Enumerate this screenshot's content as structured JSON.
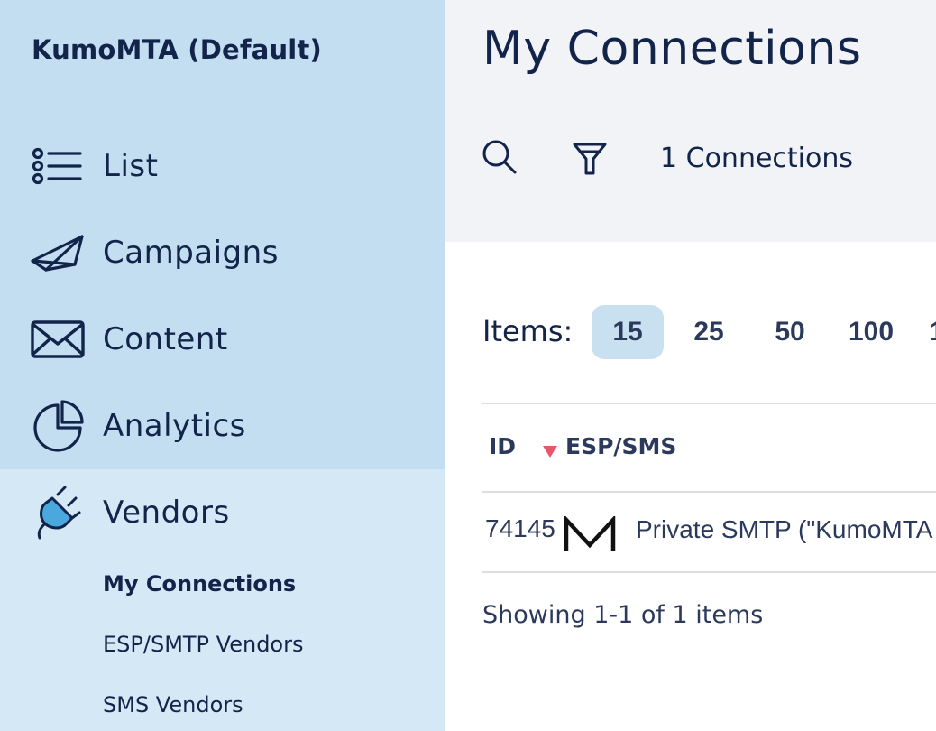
{
  "sidebar": {
    "org_name": "KumoMTA (Default)",
    "items": [
      {
        "label": "List",
        "icon": "list-icon"
      },
      {
        "label": "Campaigns",
        "icon": "paper-plane-icon"
      },
      {
        "label": "Content",
        "icon": "envelope-icon"
      },
      {
        "label": "Analytics",
        "icon": "pie-chart-icon"
      },
      {
        "label": "Vendors",
        "icon": "plug-icon"
      }
    ],
    "sub_items": [
      {
        "label": "My Connections",
        "active": true
      },
      {
        "label": "ESP/SMTP Vendors",
        "active": false
      },
      {
        "label": "SMS Vendors",
        "active": false
      }
    ]
  },
  "main": {
    "title": "My Connections",
    "toolbar": {
      "search_icon": "search-icon",
      "filter_icon": "filter-icon",
      "count_text": "1 Connections"
    },
    "pagination": {
      "items_label": "Items:",
      "sizes": [
        "15",
        "25",
        "50",
        "100",
        "1"
      ],
      "selected": "15"
    },
    "table": {
      "columns": [
        "ID",
        "ESP/SMS"
      ],
      "sort_indicator_color": "#e8566c",
      "rows": [
        {
          "id": "74145",
          "logo": "kumomta-m-logo",
          "name": "Private SMTP (\"KumoMTA D"
        }
      ]
    },
    "footer": {
      "showing": "Showing 1-1 of 1 items"
    }
  },
  "colors": {
    "sidebar_top": "#c2def0",
    "sidebar_bottom": "#d5e8f5",
    "header_bg": "#f2f3f6",
    "text_primary": "#12244a",
    "selected_page_bg": "#c8e0f0",
    "plug_fill": "#4aa8dd"
  }
}
